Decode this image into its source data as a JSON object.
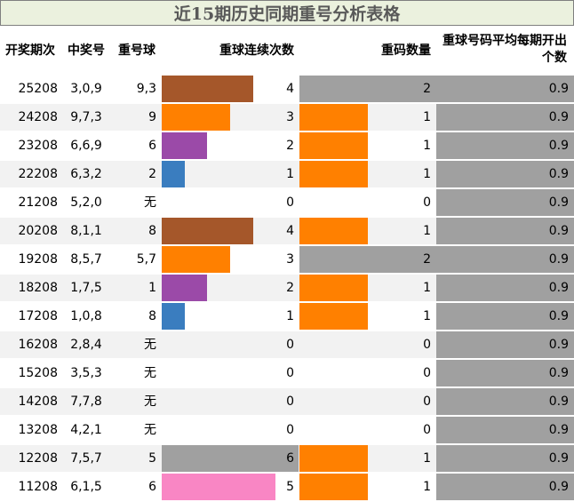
{
  "title": "近15期历史同期重号分析表格",
  "headers": [
    "开奖期次",
    "中奖号",
    "重号球",
    "重球连续次数",
    "重码数量",
    "重球号码平均每期开出个数"
  ],
  "colors": {
    "streak": {
      "1": "#3a7dbf",
      "2": "#9b4aa8",
      "3": "#ff8000",
      "4": "#a5572a",
      "5": "#f986c4",
      "6": "#a0a0a0"
    },
    "count_one": "#ff8000",
    "count_two": "#a0a0a0",
    "avg_fill": "#a0a0a0",
    "title_bg": "#ebf1de"
  },
  "rows": [
    {
      "period": "25208",
      "numbers": "3,0,9",
      "repeat": "9,3",
      "streak": 4,
      "count": 2,
      "avg": "0.9"
    },
    {
      "period": "24208",
      "numbers": "9,7,3",
      "repeat": "9",
      "streak": 3,
      "count": 1,
      "avg": "0.9"
    },
    {
      "period": "23208",
      "numbers": "6,6,9",
      "repeat": "6",
      "streak": 2,
      "count": 1,
      "avg": "0.9"
    },
    {
      "period": "22208",
      "numbers": "6,3,2",
      "repeat": "2",
      "streak": 1,
      "count": 1,
      "avg": "0.9"
    },
    {
      "period": "21208",
      "numbers": "5,2,0",
      "repeat": "无",
      "streak": 0,
      "count": 0,
      "avg": "0.9"
    },
    {
      "period": "20208",
      "numbers": "8,1,1",
      "repeat": "8",
      "streak": 4,
      "count": 1,
      "avg": "0.9"
    },
    {
      "period": "19208",
      "numbers": "8,5,7",
      "repeat": "5,7",
      "streak": 3,
      "count": 2,
      "avg": "0.9"
    },
    {
      "period": "18208",
      "numbers": "1,7,5",
      "repeat": "1",
      "streak": 2,
      "count": 1,
      "avg": "0.9"
    },
    {
      "period": "17208",
      "numbers": "1,0,8",
      "repeat": "8",
      "streak": 1,
      "count": 1,
      "avg": "0.9"
    },
    {
      "period": "16208",
      "numbers": "2,8,4",
      "repeat": "无",
      "streak": 0,
      "count": 0,
      "avg": "0.9"
    },
    {
      "period": "15208",
      "numbers": "3,5,3",
      "repeat": "无",
      "streak": 0,
      "count": 0,
      "avg": "0.9"
    },
    {
      "period": "14208",
      "numbers": "7,7,8",
      "repeat": "无",
      "streak": 0,
      "count": 0,
      "avg": "0.9"
    },
    {
      "period": "13208",
      "numbers": "4,2,1",
      "repeat": "无",
      "streak": 0,
      "count": 0,
      "avg": "0.9"
    },
    {
      "period": "12208",
      "numbers": "7,5,7",
      "repeat": "5",
      "streak": 6,
      "count": 1,
      "avg": "0.9"
    },
    {
      "period": "11208",
      "numbers": "6,1,5",
      "repeat": "6",
      "streak": 5,
      "count": 1,
      "avg": "0.9"
    }
  ]
}
